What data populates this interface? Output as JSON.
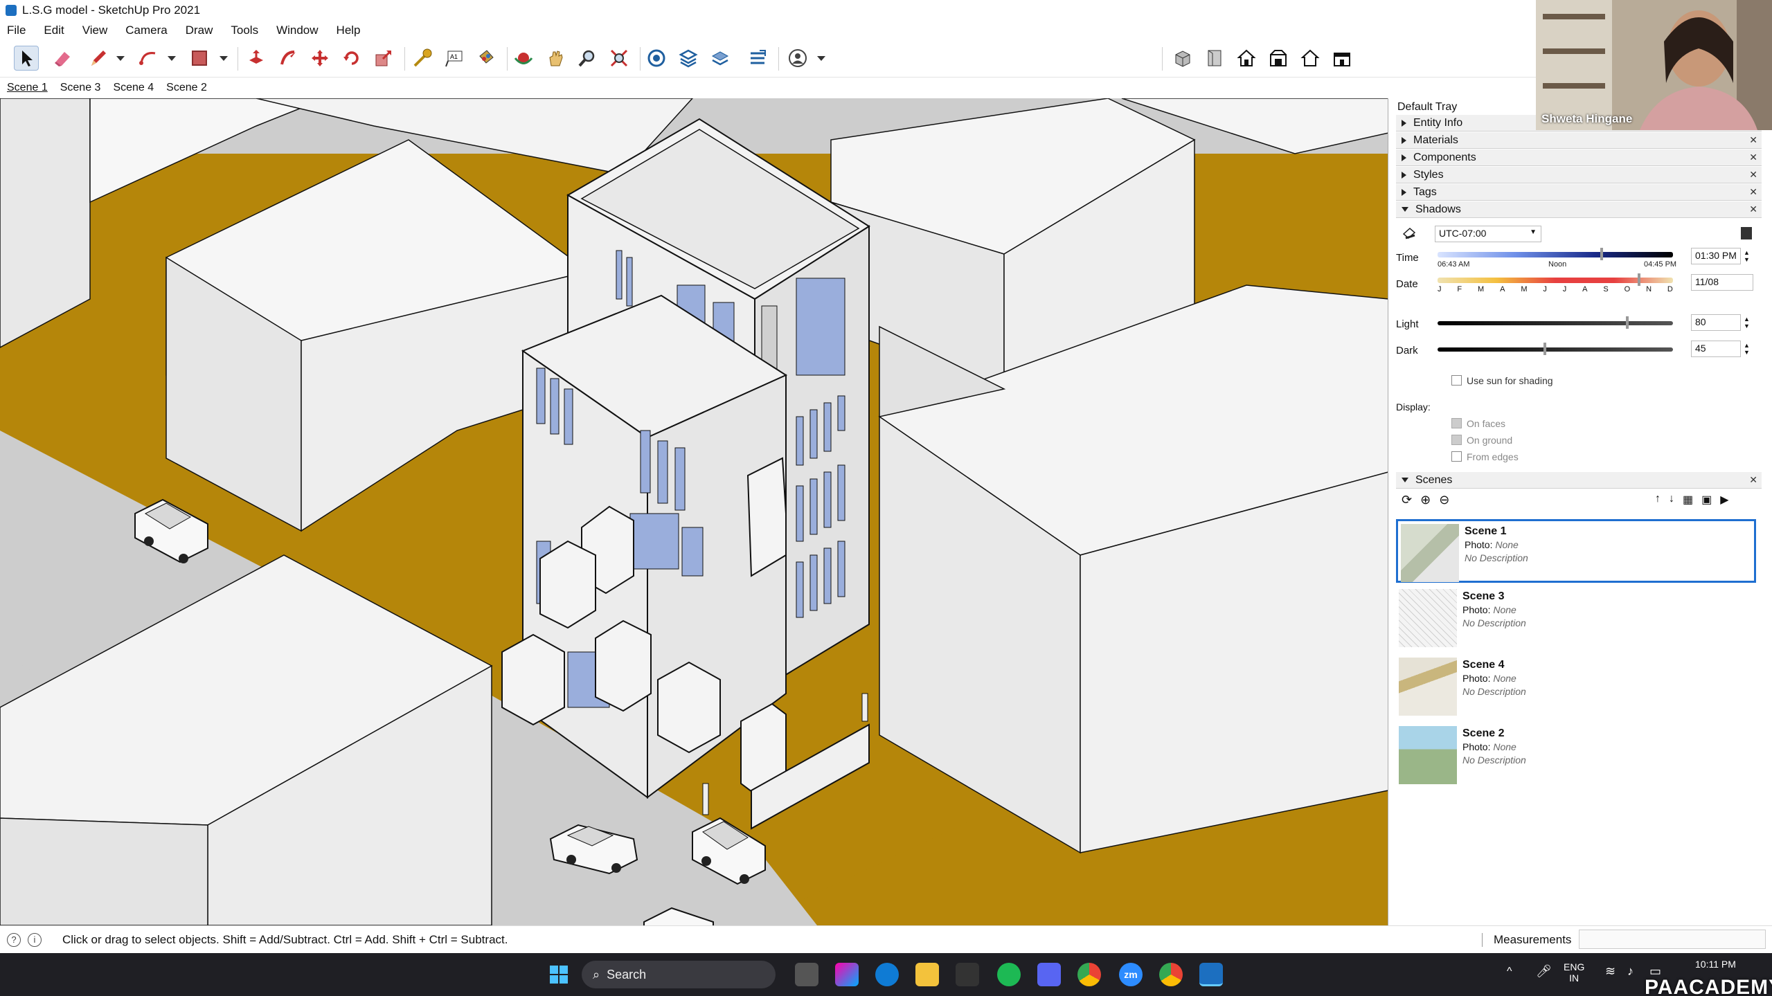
{
  "window": {
    "title": "L.S.G model - SketchUp Pro 2021"
  },
  "menu": [
    "File",
    "Edit",
    "View",
    "Camera",
    "Draw",
    "Tools",
    "Window",
    "Help"
  ],
  "toolbar": {
    "tools": [
      "select-icon",
      "eraser-icon",
      "pencil-icon",
      "arc-icon",
      "rectangle-icon",
      "push-pull-icon",
      "follow-me-icon",
      "move-icon",
      "rotate-icon",
      "scale-icon",
      "tape-measure-icon",
      "text-icon",
      "paint-bucket-icon",
      "orbit-icon",
      "pan-icon",
      "zoom-icon",
      "zoom-extents-icon",
      "sandbox-icon",
      "layers-icon",
      "section-icon",
      "warehouse-icon",
      "user-icon"
    ],
    "views": [
      "iso-view-icon",
      "top-view-icon",
      "front-view-icon",
      "right-view-icon",
      "back-view-icon",
      "left-view-icon"
    ]
  },
  "scene_tabs": [
    {
      "label": "Scene 1",
      "active": true
    },
    {
      "label": "Scene 3",
      "active": false
    },
    {
      "label": "Scene 4",
      "active": false
    },
    {
      "label": "Scene 2",
      "active": false
    }
  ],
  "tray": {
    "title": "Default Tray",
    "panels": [
      "Entity Info",
      "Materials",
      "Components",
      "Styles",
      "Tags",
      "Shadows"
    ],
    "shadows": {
      "timezone": "UTC-07:00",
      "time_label": "Time",
      "time_start": "06:43 AM",
      "time_mid": "Noon",
      "time_end": "04:45 PM",
      "time_value": "01:30 PM",
      "time_fraction": 0.69,
      "date_label": "Date",
      "months": [
        "J",
        "F",
        "M",
        "A",
        "M",
        "J",
        "J",
        "A",
        "S",
        "O",
        "N",
        "D"
      ],
      "date_value": "11/08",
      "date_fraction": 0.85,
      "light_label": "Light",
      "light_value": "80",
      "dark_label": "Dark",
      "dark_value": "45",
      "use_sun_label": "Use sun for shading",
      "display_label": "Display:",
      "on_faces_label": "On faces",
      "on_ground_label": "On ground",
      "from_edges_label": "From edges"
    },
    "scenes_panel": {
      "title": "Scenes",
      "items": [
        {
          "name": "Scene 1",
          "photo_label": "Photo:",
          "photo_value": "None",
          "description": "No Description",
          "selected": true
        },
        {
          "name": "Scene 3",
          "photo_label": "Photo:",
          "photo_value": "None",
          "description": "No Description",
          "selected": false
        },
        {
          "name": "Scene 4",
          "photo_label": "Photo:",
          "photo_value": "None",
          "description": "No Description",
          "selected": false
        },
        {
          "name": "Scene 2",
          "photo_label": "Photo:",
          "photo_value": "None",
          "description": "No Description",
          "selected": false
        }
      ]
    }
  },
  "webcam": {
    "name": "Shweta Hingane"
  },
  "status": {
    "hint": "Click or drag to select objects. Shift = Add/Subtract. Ctrl = Add. Shift + Ctrl = Subtract.",
    "measurements_label": "Measurements"
  },
  "taskbar": {
    "search_label": "Search",
    "lang_top": "ENG",
    "lang_bottom": "IN",
    "clock_time": "10:11 PM",
    "logo": "PAACADEMY"
  },
  "colors": {
    "ground": "#b5860a",
    "road": "#cdcdcd",
    "building": "#f1f1f1",
    "glass": "#9aaedc",
    "selection": "#1f6fd0"
  }
}
